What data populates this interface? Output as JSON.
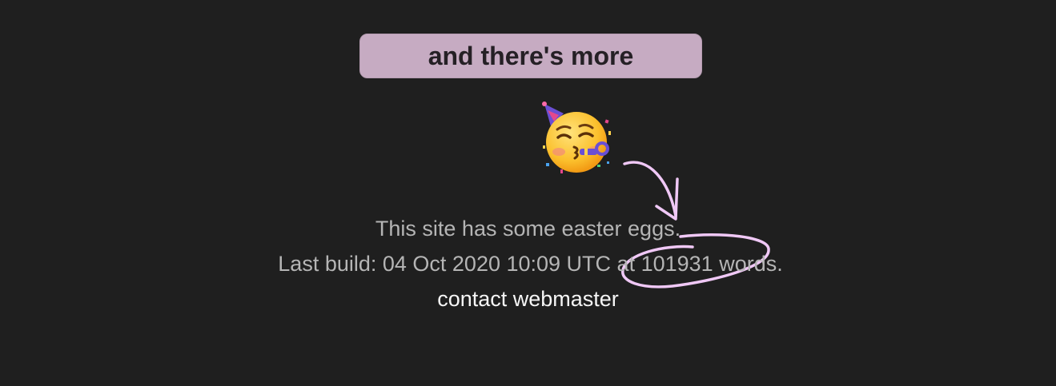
{
  "banner": {
    "label": "and there's more"
  },
  "emoji": {
    "icon": "partying-face-emoji"
  },
  "footer": {
    "easter_eggs": "This site has some easter eggs.",
    "build_prefix": "Last build: ",
    "build_date": "04 Oct 2020 10:09 UTC",
    "build_mid": " at ",
    "word_count": "101931",
    "build_suffix": " words.",
    "contact_label": "contact webmaster"
  },
  "colors": {
    "background": "#1f1f1f",
    "banner": "#c6abc2",
    "annotation": "#f0c8f6",
    "muted_text": "#b5b5b5",
    "link_text": "#f6f6f6"
  }
}
